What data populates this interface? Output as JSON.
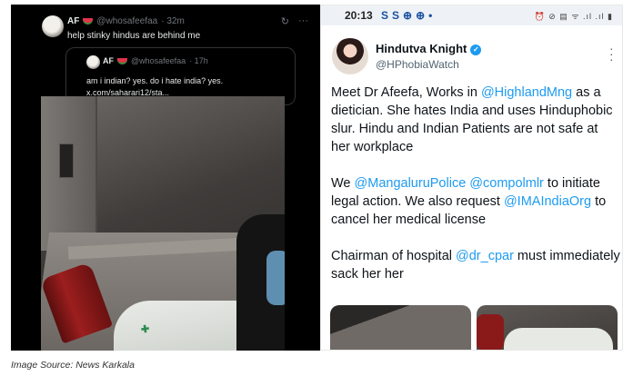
{
  "left_post": {
    "author_name": "AF",
    "handle": "@whosafeefaa",
    "age": "· 32m",
    "text": "help stinky hindus are behind me",
    "actions": [
      "↻",
      "···"
    ],
    "quote": {
      "author_name": "AF",
      "handle": "@whosafeefaa",
      "age": "· 17h",
      "lines": [
        "am i indian? yes. do i hate india? yes.",
        "x.com/saharari12/sta..."
      ]
    },
    "photo_logo_text": "✚"
  },
  "right_post": {
    "status_bar": {
      "time": "20:13",
      "notif_icons": [
        "S",
        "S",
        "⊕",
        "⊕",
        "•"
      ],
      "system_icons": "⏰ ⊘ ▤ ᯤ .ıl .ıl ▮"
    },
    "author_name": "Hindutva Knight",
    "handle": "@HPhobiaWatch",
    "paragraphs": [
      [
        {
          "t": "Meet Dr Afeefa, Works in "
        },
        {
          "t": "@HighlandMng",
          "m": true
        },
        {
          "t": " as a dietician. She hates India and uses Hinduphobic slur. Hindu and Indian Patients are not safe at her workplace"
        }
      ],
      [
        {
          "t": "We "
        },
        {
          "t": "@MangaluruPolice",
          "m": true
        },
        {
          "t": " "
        },
        {
          "t": "@compolmlr",
          "m": true
        },
        {
          "t": " to initiate legal action. We also request "
        },
        {
          "t": "@IMAIndiaOrg",
          "m": true
        },
        {
          "t": " to cancel her medical license"
        }
      ],
      [
        {
          "t": "Chairman of hospital "
        },
        {
          "t": "@dr_cpar",
          "m": true
        },
        {
          "t": " must immediately sack her her"
        }
      ]
    ]
  },
  "caption": "Image Source: News Karkala",
  "colors": {
    "mention": "#1d9bf0",
    "verified": "#1d9bf0",
    "dark_bg": "#000000"
  }
}
